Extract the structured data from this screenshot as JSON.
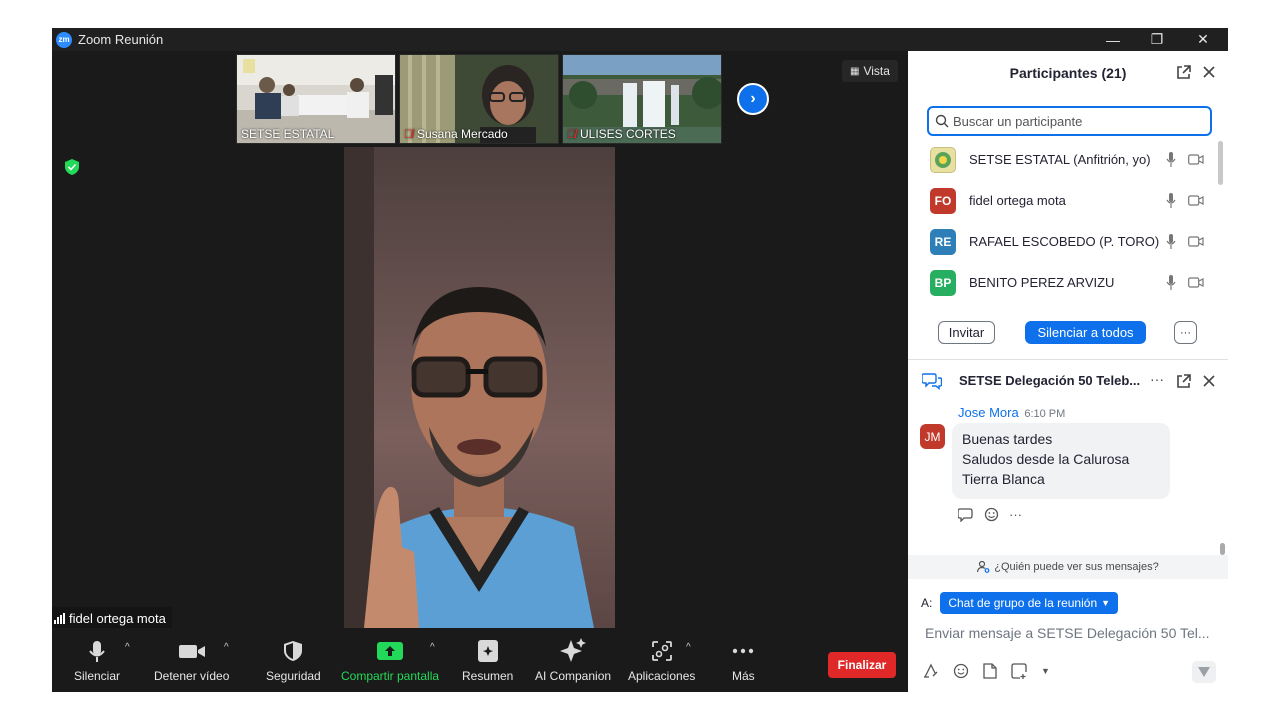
{
  "window": {
    "logo_text": "zm",
    "title": "Zoom Reunión",
    "controls": {
      "minimize": "—",
      "restore": "❐",
      "close": "✕"
    }
  },
  "thumbnails": [
    {
      "name": "SETSE ESTATAL",
      "muted": false
    },
    {
      "name": "Susana Mercado",
      "muted": true
    },
    {
      "name": "ULISES CORTES",
      "muted": true
    }
  ],
  "view_button": {
    "label": "Vista"
  },
  "active_speaker": {
    "name": "fidel ortega mota"
  },
  "toolbar": {
    "mute_label": "Silenciar",
    "video_label": "Detener vídeo",
    "security_label": "Seguridad",
    "share_label": "Compartir pantalla",
    "summary_label": "Resumen",
    "ai_label": "AI Companion",
    "apps_label": "Aplicaciones",
    "more_label": "Más",
    "end_label": "Finalizar",
    "share_color": "#23d959"
  },
  "participants_panel": {
    "title": "Participantes (21)",
    "search_placeholder": "Buscar un participante",
    "participants": [
      {
        "name": "SETSE ESTATAL (Anfitrión, yo)",
        "initials": "",
        "color": "#e8e0a0"
      },
      {
        "name": "fidel ortega mota",
        "initials": "FO",
        "color": "#c0392b"
      },
      {
        "name": "RAFAEL ESCOBEDO (P. TORO)",
        "initials": "RE",
        "color": "#2e7fb8"
      },
      {
        "name": "BENITO PEREZ ARVIZU",
        "initials": "BP",
        "color": "#27ae60"
      }
    ],
    "invite_label": "Invitar",
    "mute_all_label": "Silenciar a todos",
    "more_label": "···"
  },
  "chat_panel": {
    "title": "SETSE Delegación 50 Teleb...",
    "more_label": "···",
    "message": {
      "sender": "Jose Mora",
      "time": "6:10 PM",
      "initials": "JM",
      "line1": "Buenas tardes",
      "line2": "Saludos desde la Calurosa",
      "line3": "Tierra Blanca"
    },
    "message_more": "···",
    "who_can_see": "¿Quién puede ver sus mensajes?",
    "to_label": "A:",
    "recipient": "Chat de grupo de la reunión",
    "compose_placeholder": "Enviar mensaje a SETSE Delegación 50 Tel..."
  },
  "colors": {
    "accent": "#0e71eb",
    "end": "#e02828",
    "secure": "#23d959"
  }
}
